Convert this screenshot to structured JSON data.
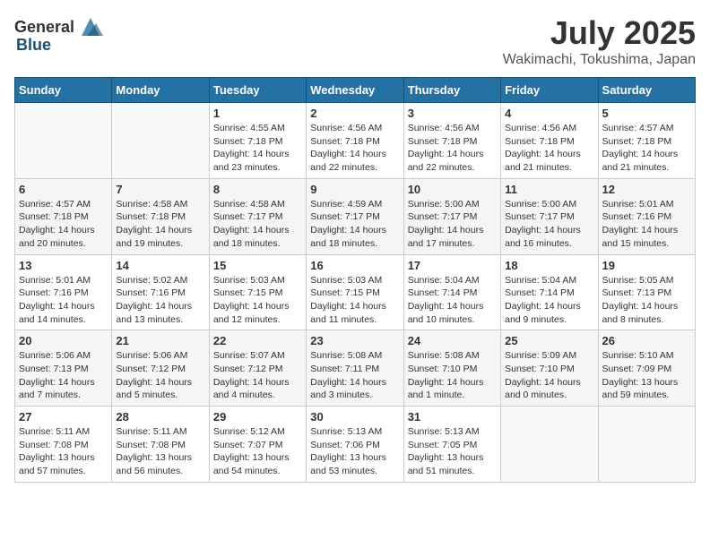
{
  "header": {
    "logo_general": "General",
    "logo_blue": "Blue",
    "month": "July 2025",
    "location": "Wakimachi, Tokushima, Japan"
  },
  "days_of_week": [
    "Sunday",
    "Monday",
    "Tuesday",
    "Wednesday",
    "Thursday",
    "Friday",
    "Saturday"
  ],
  "weeks": [
    [
      {
        "day": "",
        "detail": ""
      },
      {
        "day": "",
        "detail": ""
      },
      {
        "day": "1",
        "detail": "Sunrise: 4:55 AM\nSunset: 7:18 PM\nDaylight: 14 hours\nand 23 minutes."
      },
      {
        "day": "2",
        "detail": "Sunrise: 4:56 AM\nSunset: 7:18 PM\nDaylight: 14 hours\nand 22 minutes."
      },
      {
        "day": "3",
        "detail": "Sunrise: 4:56 AM\nSunset: 7:18 PM\nDaylight: 14 hours\nand 22 minutes."
      },
      {
        "day": "4",
        "detail": "Sunrise: 4:56 AM\nSunset: 7:18 PM\nDaylight: 14 hours\nand 21 minutes."
      },
      {
        "day": "5",
        "detail": "Sunrise: 4:57 AM\nSunset: 7:18 PM\nDaylight: 14 hours\nand 21 minutes."
      }
    ],
    [
      {
        "day": "6",
        "detail": "Sunrise: 4:57 AM\nSunset: 7:18 PM\nDaylight: 14 hours\nand 20 minutes."
      },
      {
        "day": "7",
        "detail": "Sunrise: 4:58 AM\nSunset: 7:18 PM\nDaylight: 14 hours\nand 19 minutes."
      },
      {
        "day": "8",
        "detail": "Sunrise: 4:58 AM\nSunset: 7:17 PM\nDaylight: 14 hours\nand 18 minutes."
      },
      {
        "day": "9",
        "detail": "Sunrise: 4:59 AM\nSunset: 7:17 PM\nDaylight: 14 hours\nand 18 minutes."
      },
      {
        "day": "10",
        "detail": "Sunrise: 5:00 AM\nSunset: 7:17 PM\nDaylight: 14 hours\nand 17 minutes."
      },
      {
        "day": "11",
        "detail": "Sunrise: 5:00 AM\nSunset: 7:17 PM\nDaylight: 14 hours\nand 16 minutes."
      },
      {
        "day": "12",
        "detail": "Sunrise: 5:01 AM\nSunset: 7:16 PM\nDaylight: 14 hours\nand 15 minutes."
      }
    ],
    [
      {
        "day": "13",
        "detail": "Sunrise: 5:01 AM\nSunset: 7:16 PM\nDaylight: 14 hours\nand 14 minutes."
      },
      {
        "day": "14",
        "detail": "Sunrise: 5:02 AM\nSunset: 7:16 PM\nDaylight: 14 hours\nand 13 minutes."
      },
      {
        "day": "15",
        "detail": "Sunrise: 5:03 AM\nSunset: 7:15 PM\nDaylight: 14 hours\nand 12 minutes."
      },
      {
        "day": "16",
        "detail": "Sunrise: 5:03 AM\nSunset: 7:15 PM\nDaylight: 14 hours\nand 11 minutes."
      },
      {
        "day": "17",
        "detail": "Sunrise: 5:04 AM\nSunset: 7:14 PM\nDaylight: 14 hours\nand 10 minutes."
      },
      {
        "day": "18",
        "detail": "Sunrise: 5:04 AM\nSunset: 7:14 PM\nDaylight: 14 hours\nand 9 minutes."
      },
      {
        "day": "19",
        "detail": "Sunrise: 5:05 AM\nSunset: 7:13 PM\nDaylight: 14 hours\nand 8 minutes."
      }
    ],
    [
      {
        "day": "20",
        "detail": "Sunrise: 5:06 AM\nSunset: 7:13 PM\nDaylight: 14 hours\nand 7 minutes."
      },
      {
        "day": "21",
        "detail": "Sunrise: 5:06 AM\nSunset: 7:12 PM\nDaylight: 14 hours\nand 5 minutes."
      },
      {
        "day": "22",
        "detail": "Sunrise: 5:07 AM\nSunset: 7:12 PM\nDaylight: 14 hours\nand 4 minutes."
      },
      {
        "day": "23",
        "detail": "Sunrise: 5:08 AM\nSunset: 7:11 PM\nDaylight: 14 hours\nand 3 minutes."
      },
      {
        "day": "24",
        "detail": "Sunrise: 5:08 AM\nSunset: 7:10 PM\nDaylight: 14 hours\nand 1 minute."
      },
      {
        "day": "25",
        "detail": "Sunrise: 5:09 AM\nSunset: 7:10 PM\nDaylight: 14 hours\nand 0 minutes."
      },
      {
        "day": "26",
        "detail": "Sunrise: 5:10 AM\nSunset: 7:09 PM\nDaylight: 13 hours\nand 59 minutes."
      }
    ],
    [
      {
        "day": "27",
        "detail": "Sunrise: 5:11 AM\nSunset: 7:08 PM\nDaylight: 13 hours\nand 57 minutes."
      },
      {
        "day": "28",
        "detail": "Sunrise: 5:11 AM\nSunset: 7:08 PM\nDaylight: 13 hours\nand 56 minutes."
      },
      {
        "day": "29",
        "detail": "Sunrise: 5:12 AM\nSunset: 7:07 PM\nDaylight: 13 hours\nand 54 minutes."
      },
      {
        "day": "30",
        "detail": "Sunrise: 5:13 AM\nSunset: 7:06 PM\nDaylight: 13 hours\nand 53 minutes."
      },
      {
        "day": "31",
        "detail": "Sunrise: 5:13 AM\nSunset: 7:05 PM\nDaylight: 13 hours\nand 51 minutes."
      },
      {
        "day": "",
        "detail": ""
      },
      {
        "day": "",
        "detail": ""
      }
    ]
  ]
}
